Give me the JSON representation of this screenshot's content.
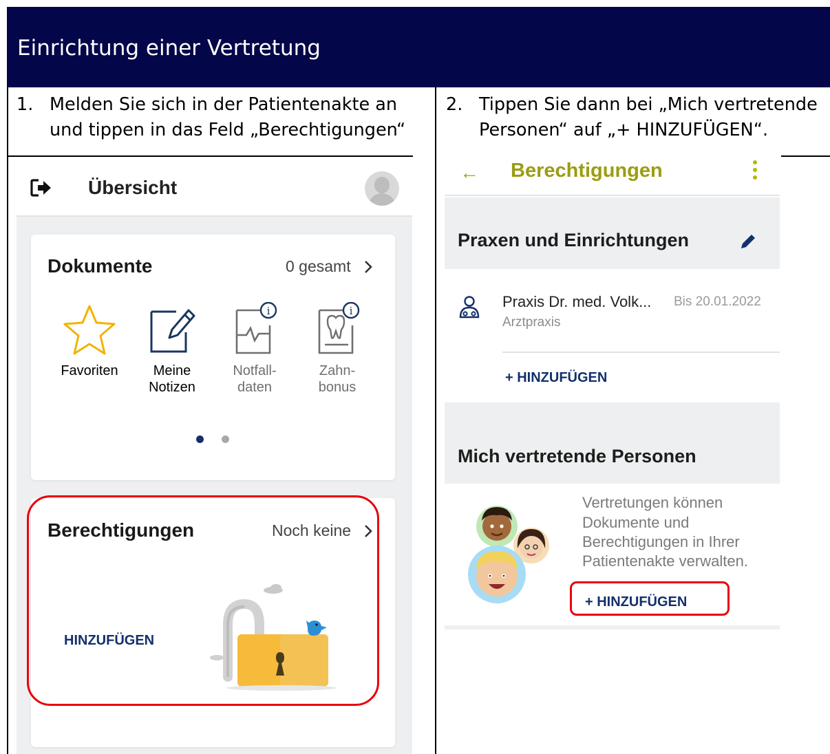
{
  "header": {
    "title": "Einrichtung einer Vertretung",
    "color": "#030649"
  },
  "steps": [
    {
      "number": "1.",
      "lines": [
        "Melden Sie sich in der Patientenakte an",
        "und tippen in das Feld „Berechtigungen“"
      ]
    },
    {
      "number": "2.",
      "lines": [
        "Tippen Sie dann bei „Mich vertretende",
        "Personen“ auf „+ HINZUFÜGEN“."
      ]
    }
  ],
  "left_screen": {
    "title": "Übersicht",
    "documents_card": {
      "title": "Dokumente",
      "count": "0 gesamt",
      "items": [
        {
          "icon": "star-icon",
          "line1": "Favoriten",
          "line2": ""
        },
        {
          "icon": "note-edit-icon",
          "line1": "Meine",
          "line2": "Notizen"
        },
        {
          "icon": "emergency-data-icon",
          "line1": "Notfall-",
          "line2": "daten"
        },
        {
          "icon": "tooth-icon",
          "line1": "Zahn-",
          "line2": "bonus"
        }
      ],
      "page_indicator": {
        "active": 1,
        "total": 2
      }
    },
    "permissions_card": {
      "title": "Berechtigungen",
      "status": "Noch keine",
      "action": "HINZUFÜGEN"
    }
  },
  "right_screen": {
    "title": "Berechtigungen",
    "practices_section": {
      "title": "Praxen und Einrichtungen",
      "entry": {
        "name": "Praxis Dr. med. Volk...",
        "until": "Bis 20.01.2022",
        "type": "Arztpraxis"
      },
      "add_label": "+ HINZUFÜGEN"
    },
    "representatives_section": {
      "title": "Mich vertretende Personen",
      "description": [
        "Vertretungen können",
        "Dokumente und",
        "Berechtigungen in Ihrer",
        "Patientenakte verwalten."
      ],
      "add_label": "+ HINZUFÜGEN"
    },
    "accent_color": "#9b9d12",
    "link_color": "#13306b"
  },
  "highlight_color": "#e8000b"
}
